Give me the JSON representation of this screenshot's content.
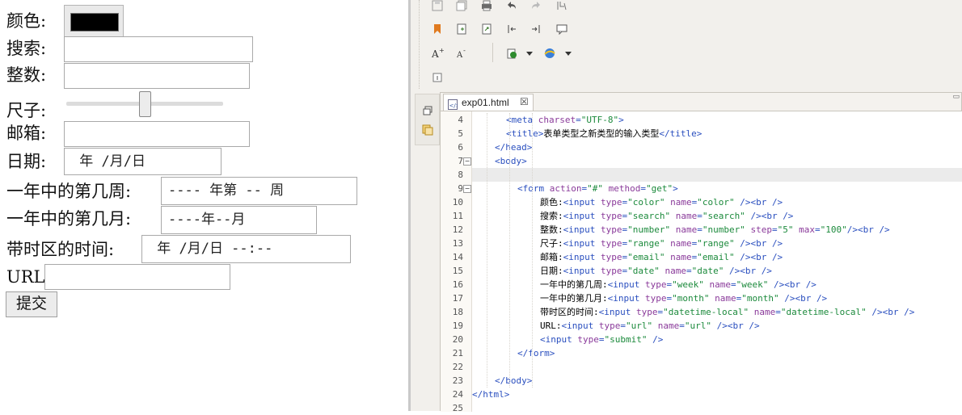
{
  "form": {
    "labels": {
      "color": "颜色:",
      "search": "搜索:",
      "number": "整数:",
      "range": "尺子:",
      "email": "邮箱:",
      "date": "日期:",
      "week": "一年中的第几周:",
      "month": "一年中的第几月:",
      "datetime": "带时区的时间:",
      "url": "URL:"
    },
    "values": {
      "color": "#000000",
      "date": " 年 /月/日",
      "week": "---- 年第 -- 周",
      "month": "----年--月",
      "datetime": " 年 /月/日 --:--"
    },
    "range_value_fraction": 0.5,
    "submit_label": "提交"
  },
  "ide": {
    "tab": {
      "title": "exp01.html",
      "close": "☒"
    },
    "toolbar_icons": [
      "save-icon",
      "save-all-icon",
      "print-icon",
      "undo-icon",
      "redo-icon",
      "format-icon",
      "bookmark-icon",
      "new-file-icon",
      "export-icon",
      "shift-left-icon",
      "shift-right-icon",
      "comment-icon",
      "font-increase-icon",
      "font-decrease-icon",
      "run-icon",
      "dropdown-icon",
      "browser-icon",
      "dropdown-icon",
      "info-icon"
    ],
    "code_lines": [
      {
        "n": "4",
        "indent": 3,
        "parts": [
          [
            "tag",
            "<meta "
          ],
          [
            "attr",
            "charset"
          ],
          [
            "tag",
            "="
          ],
          [
            "str",
            "\"UTF-8\""
          ],
          [
            "tag",
            ">"
          ]
        ]
      },
      {
        "n": "5",
        "indent": 3,
        "parts": [
          [
            "tag",
            "<title>"
          ],
          [
            "txt",
            "表单类型之新类型的输入类型"
          ],
          [
            "tag",
            "</title>"
          ]
        ]
      },
      {
        "n": "6",
        "indent": 2,
        "parts": [
          [
            "tag",
            "</head>"
          ]
        ]
      },
      {
        "n": "7",
        "indent": 2,
        "fold": "−",
        "parts": [
          [
            "tag",
            "<body>"
          ]
        ]
      },
      {
        "n": "8",
        "indent": 0,
        "highlight": true,
        "parts": []
      },
      {
        "n": "9",
        "indent": 4,
        "fold": "−",
        "parts": [
          [
            "tag",
            "<form "
          ],
          [
            "attr",
            "action"
          ],
          [
            "tag",
            "="
          ],
          [
            "str",
            "\"#\" "
          ],
          [
            "attr",
            "method"
          ],
          [
            "tag",
            "="
          ],
          [
            "str",
            "\"get\""
          ],
          [
            "tag",
            ">"
          ]
        ]
      },
      {
        "n": "10",
        "indent": 6,
        "parts": [
          [
            "txt",
            "颜色:"
          ],
          [
            "tag",
            "<input "
          ],
          [
            "attr",
            "type"
          ],
          [
            "tag",
            "="
          ],
          [
            "str",
            "\"color\" "
          ],
          [
            "attr",
            "name"
          ],
          [
            "tag",
            "="
          ],
          [
            "str",
            "\"color\" "
          ],
          [
            "tag",
            "/><br />"
          ]
        ]
      },
      {
        "n": "11",
        "indent": 6,
        "parts": [
          [
            "txt",
            "搜索:"
          ],
          [
            "tag",
            "<input "
          ],
          [
            "attr",
            "type"
          ],
          [
            "tag",
            "="
          ],
          [
            "str",
            "\"search\" "
          ],
          [
            "attr",
            "name"
          ],
          [
            "tag",
            "="
          ],
          [
            "str",
            "\"search\" "
          ],
          [
            "tag",
            "/><br />"
          ]
        ]
      },
      {
        "n": "12",
        "indent": 6,
        "parts": [
          [
            "txt",
            "整数:"
          ],
          [
            "tag",
            "<input "
          ],
          [
            "attr",
            "type"
          ],
          [
            "tag",
            "="
          ],
          [
            "str",
            "\"number\" "
          ],
          [
            "attr",
            "name"
          ],
          [
            "tag",
            "="
          ],
          [
            "str",
            "\"number\" "
          ],
          [
            "attr",
            "step"
          ],
          [
            "tag",
            "="
          ],
          [
            "str",
            "\"5\" "
          ],
          [
            "attr",
            "max"
          ],
          [
            "tag",
            "="
          ],
          [
            "str",
            "\"100\""
          ],
          [
            "tag",
            "/><br />"
          ]
        ]
      },
      {
        "n": "13",
        "indent": 6,
        "parts": [
          [
            "txt",
            "尺子:"
          ],
          [
            "tag",
            "<input "
          ],
          [
            "attr",
            "type"
          ],
          [
            "tag",
            "="
          ],
          [
            "str",
            "\"range\" "
          ],
          [
            "attr",
            "name"
          ],
          [
            "tag",
            "="
          ],
          [
            "str",
            "\"range\" "
          ],
          [
            "tag",
            "/><br />"
          ]
        ]
      },
      {
        "n": "14",
        "indent": 6,
        "parts": [
          [
            "txt",
            "邮箱:"
          ],
          [
            "tag",
            "<input "
          ],
          [
            "attr",
            "type"
          ],
          [
            "tag",
            "="
          ],
          [
            "str",
            "\"email\" "
          ],
          [
            "attr",
            "name"
          ],
          [
            "tag",
            "="
          ],
          [
            "str",
            "\"email\" "
          ],
          [
            "tag",
            "/><br />"
          ]
        ]
      },
      {
        "n": "15",
        "indent": 6,
        "parts": [
          [
            "txt",
            "日期:"
          ],
          [
            "tag",
            "<input "
          ],
          [
            "attr",
            "type"
          ],
          [
            "tag",
            "="
          ],
          [
            "str",
            "\"date\" "
          ],
          [
            "attr",
            "name"
          ],
          [
            "tag",
            "="
          ],
          [
            "str",
            "\"date\" "
          ],
          [
            "tag",
            "/><br />"
          ]
        ]
      },
      {
        "n": "16",
        "indent": 6,
        "parts": [
          [
            "txt",
            "一年中的第几周:"
          ],
          [
            "tag",
            "<input "
          ],
          [
            "attr",
            "type"
          ],
          [
            "tag",
            "="
          ],
          [
            "str",
            "\"week\" "
          ],
          [
            "attr",
            "name"
          ],
          [
            "tag",
            "="
          ],
          [
            "str",
            "\"week\" "
          ],
          [
            "tag",
            "/><br />"
          ]
        ]
      },
      {
        "n": "17",
        "indent": 6,
        "parts": [
          [
            "txt",
            "一年中的第几月:"
          ],
          [
            "tag",
            "<input "
          ],
          [
            "attr",
            "type"
          ],
          [
            "tag",
            "="
          ],
          [
            "str",
            "\"month\" "
          ],
          [
            "attr",
            "name"
          ],
          [
            "tag",
            "="
          ],
          [
            "str",
            "\"month\" "
          ],
          [
            "tag",
            "/><br />"
          ]
        ]
      },
      {
        "n": "18",
        "indent": 6,
        "parts": [
          [
            "txt",
            "带时区的时间:"
          ],
          [
            "tag",
            "<input "
          ],
          [
            "attr",
            "type"
          ],
          [
            "tag",
            "="
          ],
          [
            "str",
            "\"datetime-local\" "
          ],
          [
            "attr",
            "name"
          ],
          [
            "tag",
            "="
          ],
          [
            "str",
            "\"datetime-local\" "
          ],
          [
            "tag",
            "/><br />"
          ]
        ]
      },
      {
        "n": "19",
        "indent": 6,
        "parts": [
          [
            "txt",
            "URL:"
          ],
          [
            "tag",
            "<input "
          ],
          [
            "attr",
            "type"
          ],
          [
            "tag",
            "="
          ],
          [
            "str",
            "\"url\" "
          ],
          [
            "attr",
            "name"
          ],
          [
            "tag",
            "="
          ],
          [
            "str",
            "\"url\" "
          ],
          [
            "tag",
            "/><br />"
          ]
        ]
      },
      {
        "n": "20",
        "indent": 6,
        "parts": [
          [
            "tag",
            "<input "
          ],
          [
            "attr",
            "type"
          ],
          [
            "tag",
            "="
          ],
          [
            "str",
            "\"submit\" "
          ],
          [
            "tag",
            "/>"
          ]
        ]
      },
      {
        "n": "21",
        "indent": 4,
        "parts": [
          [
            "tag",
            "</form>"
          ]
        ]
      },
      {
        "n": "22",
        "indent": 0,
        "parts": []
      },
      {
        "n": "23",
        "indent": 2,
        "parts": [
          [
            "tag",
            "</body>"
          ]
        ]
      },
      {
        "n": "24",
        "indent": 0,
        "parts": [
          [
            "tag",
            "</html>"
          ]
        ]
      },
      {
        "n": "25",
        "indent": 0,
        "parts": []
      }
    ]
  }
}
